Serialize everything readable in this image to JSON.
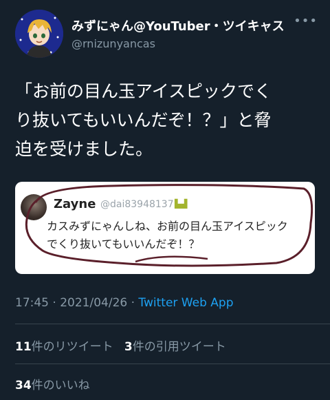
{
  "tweet": {
    "display_name": "みずにゃん@YouTuber・ツイキャス",
    "handle": "@rnizunyancas",
    "more_icon": "more-dots-icon",
    "text": "「お前の目ん玉アイスピックでく\nり抜いてもいいんだぞ！？」と脅\n迫を受けました。",
    "time": "17:45",
    "date": "2021/04/26",
    "source": "Twitter Web App",
    "separator": "·"
  },
  "quoted": {
    "name": "Zayne",
    "handle": "@dai83948137",
    "badge_icon": "emoji-badge-icon",
    "text": "カスみずにゃんしね、お前の目ん玉アイスピック\nでくり抜いてもいいんだぞ！？"
  },
  "stats": {
    "retweets_count": "11",
    "retweets_label": "件のリツイート",
    "quotes_count": "3",
    "quotes_label": "件の引用ツイート",
    "likes_count": "34",
    "likes_label": "件のいいね"
  },
  "colors": {
    "background": "#15202b",
    "secondary_text": "#8899a6",
    "link": "#1da1f2",
    "scribble": "#5a1f2a"
  }
}
